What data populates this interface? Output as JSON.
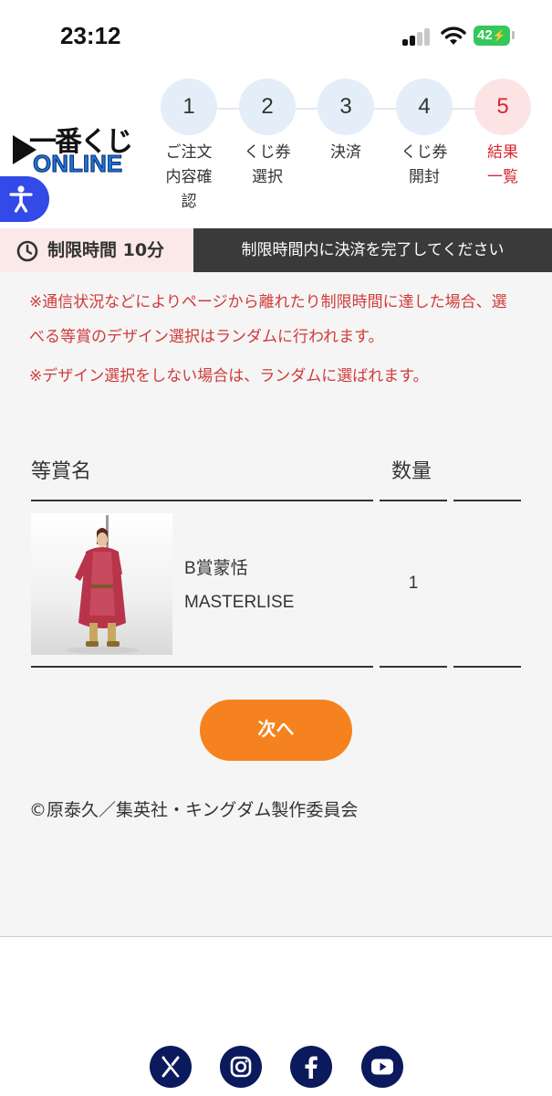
{
  "status_bar": {
    "time": "23:12",
    "battery": "42"
  },
  "logo": {
    "top_text": "一番くじ",
    "bottom_text": "ONLINE"
  },
  "steps": [
    {
      "number": "1",
      "label": "ご注文\n内容確\n認"
    },
    {
      "number": "2",
      "label": "くじ券\n選択"
    },
    {
      "number": "3",
      "label": "決済"
    },
    {
      "number": "4",
      "label": "くじ券\n開封"
    },
    {
      "number": "5",
      "label": "結果\n一覧"
    }
  ],
  "active_step": 5,
  "timer": {
    "label": "制限時間 10分",
    "message": "制限時間内に決済を完了してください"
  },
  "notices": [
    "※通信状況などによりページから離れたり制限時間に達した場合、選べる等賞のデザイン選択はランダムに行われます。",
    "※デザイン選択をしない場合は、ランダムに選ばれます。"
  ],
  "table": {
    "headers": {
      "name": "等賞名",
      "quantity": "数量"
    },
    "rows": [
      {
        "name_line1": "B賞蒙恬",
        "name_line2": "MASTERLISE",
        "quantity": "1"
      }
    ]
  },
  "next_button": "次へ",
  "copyright": "©原泰久／集英社・キングダム製作委員会",
  "social_icons": [
    "x-icon",
    "instagram-icon",
    "facebook-icon",
    "youtube-icon"
  ],
  "colors": {
    "accent_orange": "#f5821f",
    "notice_red": "#d03a3a",
    "active_step_red": "#d8262f",
    "step_circle_bg": "#e3eef8",
    "social_navy": "#0b1a5c"
  }
}
